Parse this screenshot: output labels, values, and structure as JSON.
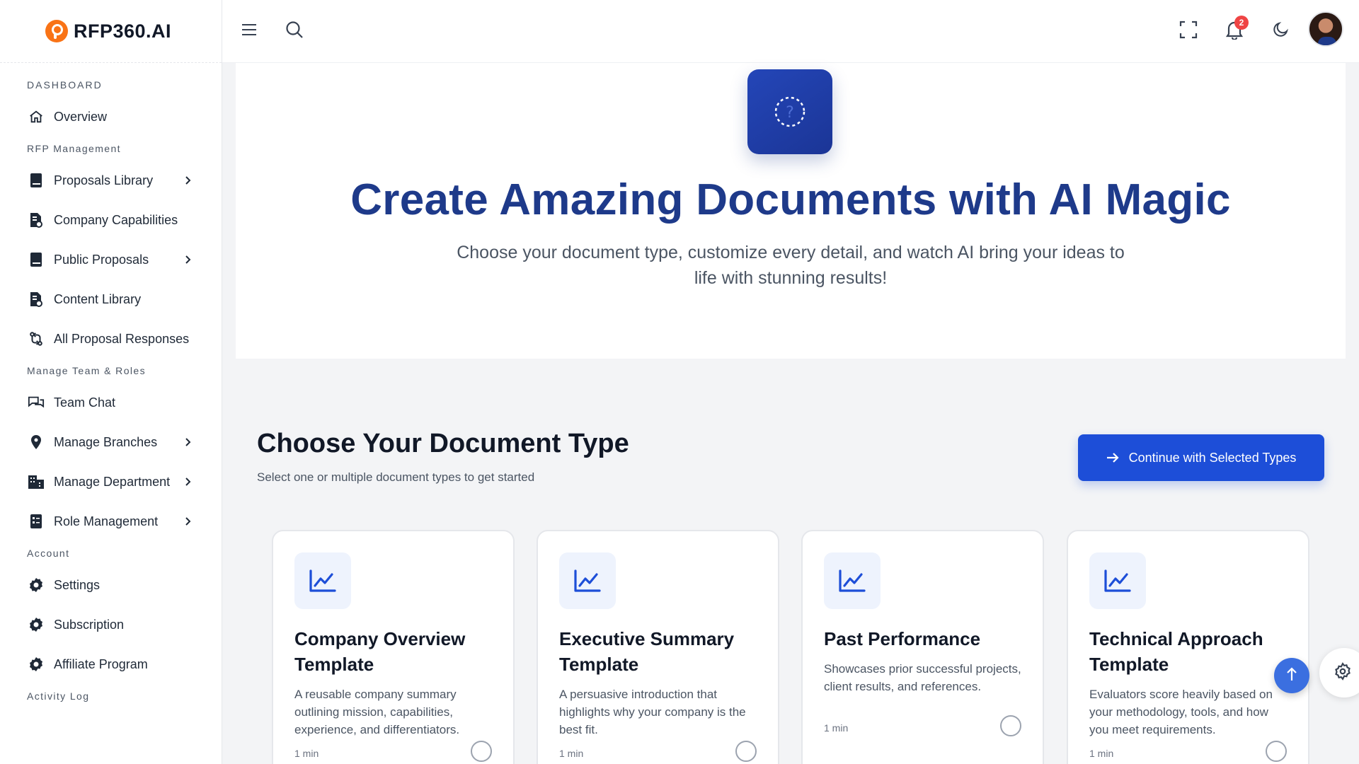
{
  "brand": {
    "name": "RFP360.AI",
    "accent": "#f97316"
  },
  "header": {
    "notification_count": "2"
  },
  "sidebar": {
    "sections": {
      "dashboard": "DASHBOARD",
      "rfp": "RFP Management",
      "team": "Manage Team & Roles",
      "account": "Account",
      "activity": "Activity Log"
    },
    "items": {
      "overview": "Overview",
      "proposals_library": "Proposals Library",
      "company_capabilities": "Company Capabilities",
      "public_proposals": "Public Proposals",
      "content_library": "Content Library",
      "all_proposal_responses": "All Proposal Responses",
      "team_chat": "Team Chat",
      "manage_branches": "Manage Branches",
      "manage_department": "Manage Department",
      "role_management": "Role Management",
      "settings": "Settings",
      "subscription": "Subscription",
      "affiliate_program": "Affiliate Program"
    }
  },
  "hero": {
    "title": "Create Amazing Documents with AI Magic",
    "subtitle": "Choose your document type, customize every detail, and watch AI bring your ideas to life with stunning results!"
  },
  "section": {
    "title": "Choose Your Document Type",
    "subtitle": "Select one or multiple document types to get started",
    "continue_label": "Continue with Selected Types"
  },
  "cards": [
    {
      "title": "Company Overview Template",
      "desc": "A reusable company summary outlining mission, capabilities, experience, and differentiators.",
      "time": "1 min"
    },
    {
      "title": "Executive Summary Template",
      "desc": "A persuasive introduction that highlights why your company is the best fit.",
      "time": "1 min"
    },
    {
      "title": "Past Performance",
      "desc": "Showcases prior successful projects, client results, and references.",
      "time": "1 min"
    },
    {
      "title": "Technical Approach Template",
      "desc": "Evaluators score heavily based on your methodology, tools, and how you meet requirements.",
      "time": "1 min"
    }
  ],
  "colors": {
    "primary": "#1d4ed8",
    "heading": "#1e3a8a",
    "badge": "#ef4444"
  }
}
